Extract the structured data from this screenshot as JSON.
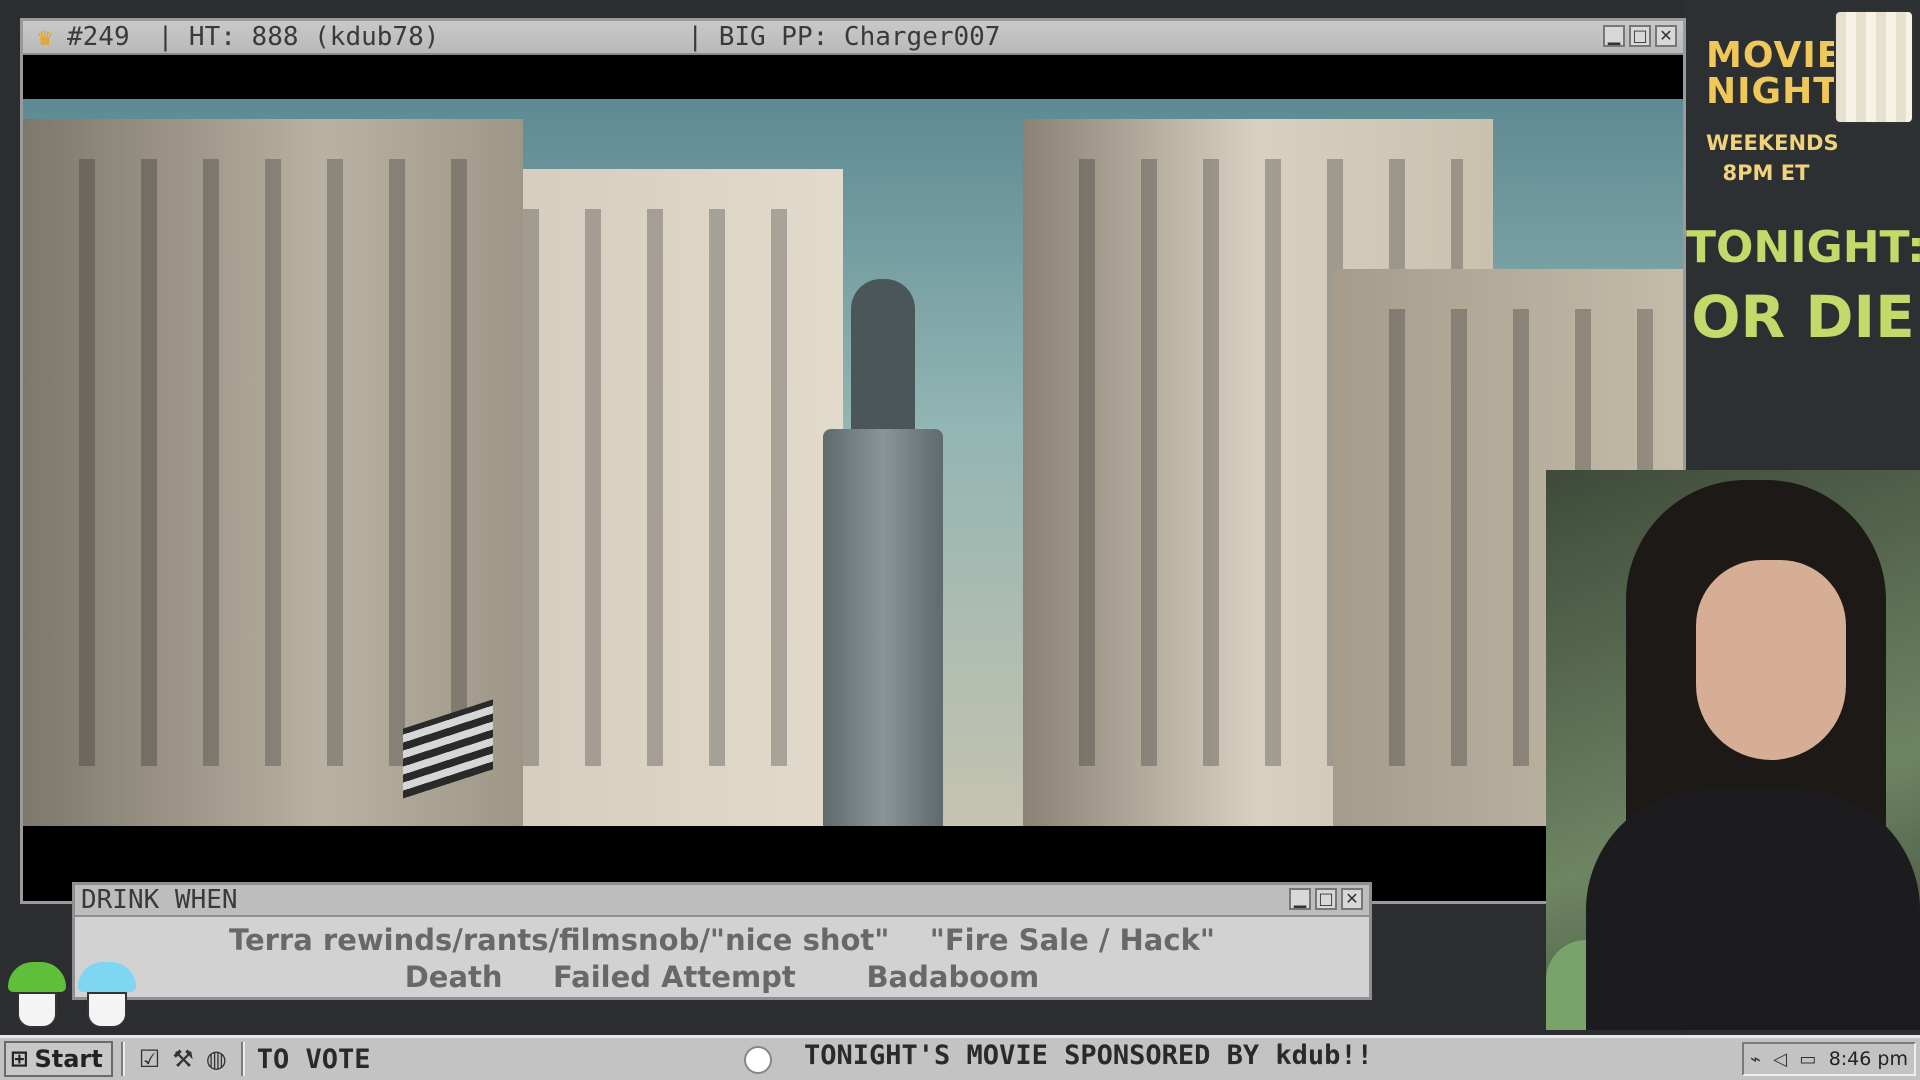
{
  "video_window": {
    "titlebar": {
      "rank": "#249",
      "ht": "| HT: 888 (kdub78)",
      "big_pp": "| BIG PP: Charger007"
    }
  },
  "drink_window": {
    "title": "DRINK WHEN",
    "row1": "Terra rewinds/rants/filmsnob/\"nice shot\"    \"Fire Sale / Hack\"",
    "row2": "Death     Failed Attempt       Badaboom"
  },
  "sidebar": {
    "movie_night_line1": "MOVIE",
    "movie_night_line2": "NIGHT",
    "weekends_line1": "WEEKENDS",
    "weekends_line2": "8PM ET",
    "tonight_label": "TONIGHT:",
    "tonight_movie": "OR DIE"
  },
  "taskbar": {
    "start_label": "Start",
    "to_vote": "TO VOTE",
    "ticker": "TONIGHT'S MOVIE SPONSORED BY kdub!!",
    "clock": "8:46 pm"
  },
  "icons": {
    "crown": "crown-icon",
    "minimize": "minimize-icon",
    "maximize": "maximize-icon",
    "close": "close-icon",
    "start_logo": "windows-logo-icon",
    "quick_launch": [
      "checklist-icon",
      "tools-icon",
      "browser-icon"
    ],
    "tray": [
      "network-icon",
      "volume-icon",
      "display-icon"
    ]
  },
  "colors": {
    "accent_gold": "#f0c85a",
    "tonight_green": "#c5d86a",
    "titlebar_gray": "#c3c3c3"
  }
}
